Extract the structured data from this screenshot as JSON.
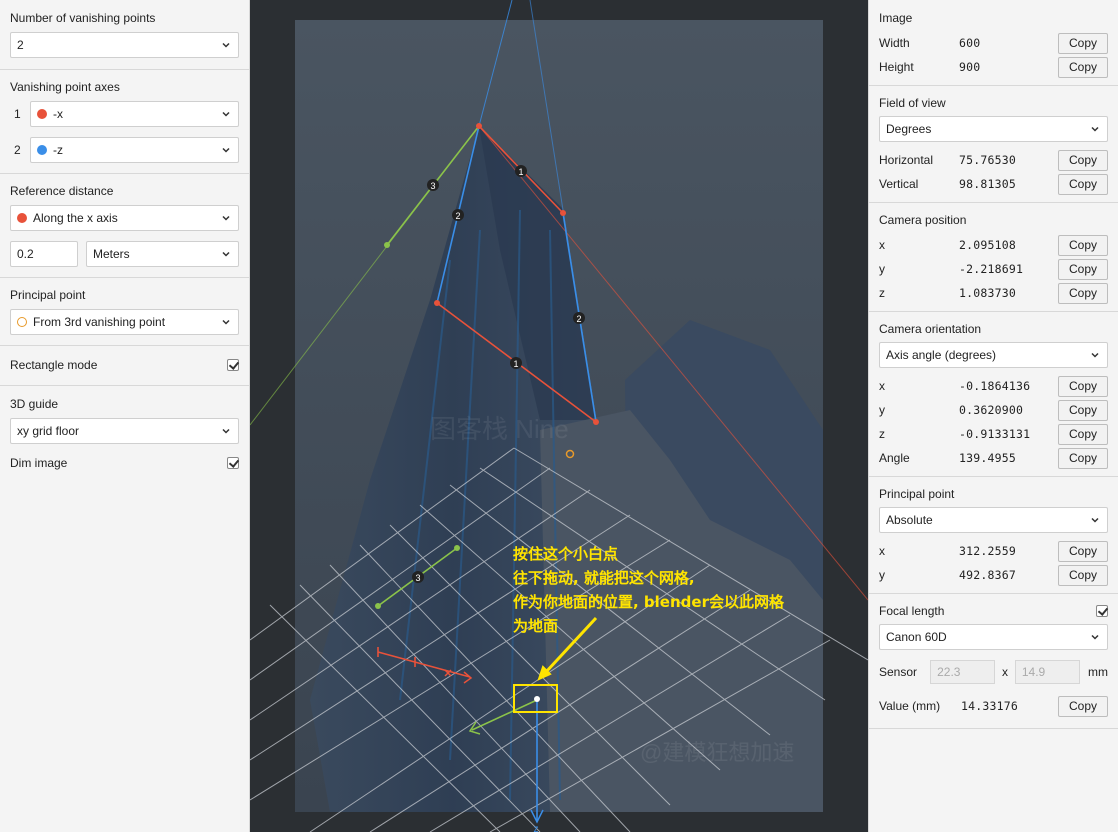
{
  "left": {
    "vp_count": {
      "label": "Number of vanishing points",
      "value": "2"
    },
    "vp_axes": {
      "label": "Vanishing point axes",
      "items": [
        {
          "num": "1",
          "value": "-x",
          "color": "#e8523a"
        },
        {
          "num": "2",
          "value": "-z",
          "color": "#3a8ee8"
        }
      ]
    },
    "ref_distance": {
      "label": "Reference distance",
      "mode": "Along the x axis",
      "mode_color": "#e8523a",
      "value": "0.2",
      "unit": "Meters"
    },
    "principal_point": {
      "label": "Principal point",
      "value": "From 3rd vanishing point",
      "color": "#e89a2a"
    },
    "rectangle_mode": {
      "label": "Rectangle mode",
      "checked": true
    },
    "guide": {
      "label": "3D guide",
      "value": "xy grid floor"
    },
    "dim_image": {
      "label": "Dim image",
      "checked": true
    }
  },
  "canvas": {
    "annotation": {
      "line1": "按住这个小白点",
      "line2": "往下拖动, 就能把这个网格,",
      "line3": "作为你地面的位置, blender会以此网格",
      "line4": "为地面",
      "color": "#ffe400"
    },
    "watermark1": "图客栈 Nine",
    "watermark2": "@建模狂想加速",
    "axis_label_x": "x",
    "axis_label_y": "y",
    "axis_label_z": "z",
    "markers": {
      "one": "1",
      "two": "2",
      "three": "3"
    }
  },
  "right": {
    "copy_label": "Copy",
    "image": {
      "title": "Image",
      "width_label": "Width",
      "width": "600",
      "height_label": "Height",
      "height": "900"
    },
    "fov": {
      "title": "Field of view",
      "unit": "Degrees",
      "h_label": "Horizontal",
      "h": "75.76530",
      "v_label": "Vertical",
      "v": "98.81305"
    },
    "cam_pos": {
      "title": "Camera position",
      "x_label": "x",
      "x": "2.095108",
      "y_label": "y",
      "y": "-2.218691",
      "z_label": "z",
      "z": "1.083730"
    },
    "cam_orient": {
      "title": "Camera orientation",
      "mode": "Axis angle (degrees)",
      "x_label": "x",
      "x": "-0.1864136",
      "y_label": "y",
      "y": "0.3620900",
      "z_label": "z",
      "z": "-0.9133131",
      "a_label": "Angle",
      "a": "139.4955"
    },
    "pp": {
      "title": "Principal point",
      "mode": "Absolute",
      "x_label": "x",
      "x": "312.2559",
      "y_label": "y",
      "y": "492.8367"
    },
    "focal": {
      "title": "Focal length",
      "checked": true,
      "camera": "Canon 60D",
      "sensor_label": "Sensor",
      "sensor_w": "22.3",
      "sensor_x": "x",
      "sensor_h": "14.9",
      "sensor_unit": "mm",
      "value_label": "Value (mm)",
      "value": "14.33176"
    }
  }
}
